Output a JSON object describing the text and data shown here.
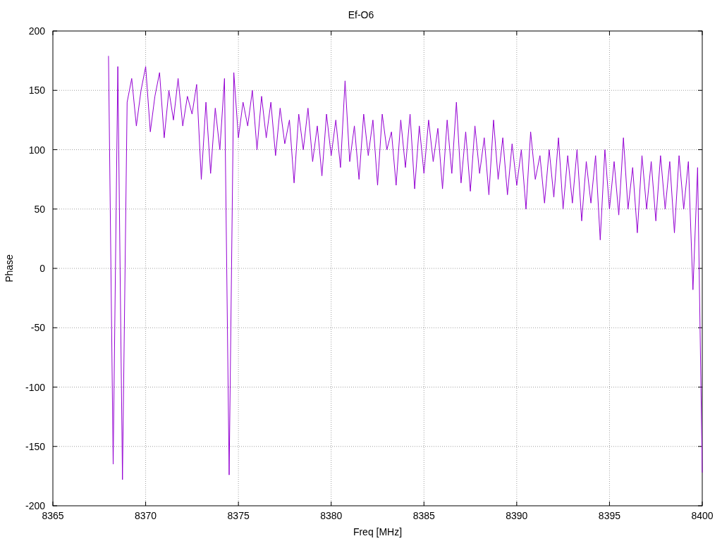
{
  "chart_data": {
    "type": "line",
    "grid": true,
    "title": "Ef-O6",
    "xlabel": "Freq [MHz]",
    "ylabel": "Phase",
    "xlim": [
      8365,
      8400
    ],
    "ylim": [
      -200,
      200
    ],
    "xticks": [
      8365,
      8370,
      8375,
      8380,
      8385,
      8390,
      8395,
      8400
    ],
    "yticks": [
      -200,
      -150,
      -100,
      -50,
      0,
      50,
      100,
      150,
      200
    ],
    "x": [
      8368,
      8368.25,
      8368.5,
      8368.75,
      8369,
      8369.25,
      8369.5,
      8369.75,
      8370,
      8370.25,
      8370.5,
      8370.75,
      8371,
      8371.25,
      8371.5,
      8371.75,
      8372,
      8372.25,
      8372.5,
      8372.75,
      8373,
      8373.25,
      8373.5,
      8373.75,
      8374,
      8374.25,
      8374.5,
      8374.75,
      8375,
      8375.25,
      8375.5,
      8375.75,
      8376,
      8376.25,
      8376.5,
      8376.75,
      8377,
      8377.25,
      8377.5,
      8377.75,
      8378,
      8378.25,
      8378.5,
      8378.75,
      8379,
      8379.25,
      8379.5,
      8379.75,
      8380,
      8380.25,
      8380.5,
      8380.75,
      8381,
      8381.25,
      8381.5,
      8381.75,
      8382,
      8382.25,
      8382.5,
      8382.75,
      8383,
      8383.25,
      8383.5,
      8383.75,
      8384,
      8384.25,
      8384.5,
      8384.75,
      8385,
      8385.25,
      8385.5,
      8385.75,
      8386,
      8386.25,
      8386.5,
      8386.75,
      8387,
      8387.25,
      8387.5,
      8387.75,
      8388,
      8388.25,
      8388.5,
      8388.75,
      8389,
      8389.25,
      8389.5,
      8389.75,
      8390,
      8390.25,
      8390.5,
      8390.75,
      8391,
      8391.25,
      8391.5,
      8391.75,
      8392,
      8392.25,
      8392.5,
      8392.75,
      8393,
      8393.25,
      8393.5,
      8393.75,
      8394,
      8394.25,
      8394.5,
      8394.75,
      8395,
      8395.25,
      8395.5,
      8395.75,
      8396,
      8396.25,
      8396.5,
      8396.75,
      8397,
      8397.25,
      8397.5,
      8397.75,
      8398,
      8398.25,
      8398.5,
      8398.75,
      8399,
      8399.25,
      8399.5,
      8399.75,
      8400
    ],
    "series": [
      {
        "color": "#9400d3",
        "values": [
          179,
          -165,
          170,
          -178,
          140,
          160,
          120,
          150,
          170,
          115,
          145,
          165,
          110,
          150,
          125,
          160,
          120,
          145,
          130,
          155,
          75,
          140,
          80,
          135,
          100,
          160,
          -174,
          165,
          110,
          140,
          120,
          150,
          100,
          145,
          110,
          140,
          95,
          135,
          105,
          125,
          72,
          130,
          100,
          135,
          90,
          120,
          78,
          130,
          95,
          125,
          85,
          158,
          90,
          120,
          75,
          130,
          95,
          125,
          70,
          130,
          100,
          115,
          70,
          125,
          85,
          130,
          67,
          120,
          80,
          125,
          90,
          118,
          67,
          125,
          80,
          140,
          72,
          115,
          65,
          120,
          80,
          110,
          62,
          125,
          75,
          110,
          62,
          105,
          70,
          100,
          50,
          115,
          75,
          95,
          55,
          100,
          60,
          110,
          50,
          95,
          55,
          100,
          40,
          90,
          55,
          95,
          24,
          100,
          50,
          90,
          45,
          110,
          50,
          85,
          30,
          95,
          50,
          90,
          40,
          95,
          50,
          90,
          30,
          95,
          50,
          90,
          -18,
          85,
          -172
        ]
      }
    ]
  }
}
